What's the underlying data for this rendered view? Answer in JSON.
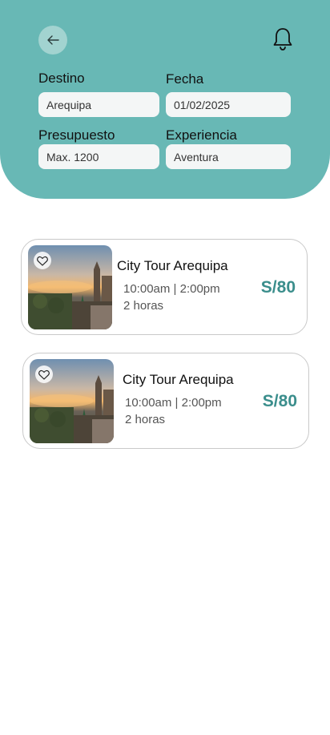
{
  "colors": {
    "header_bg": "#68b8b5",
    "accent": "#3b8e8c",
    "field_bg": "#f4f6f6"
  },
  "header": {
    "back_icon": "arrow-left-icon",
    "bell_icon": "bell-icon"
  },
  "filters": {
    "destino": {
      "label": "Destino",
      "value": "Arequipa"
    },
    "fecha": {
      "label": "Fecha",
      "value": "01/02/2025"
    },
    "presupuesto": {
      "label": "Presupuesto",
      "value": "Max. 1200"
    },
    "experiencia": {
      "label": "Experiencia",
      "value": "Aventura"
    }
  },
  "tours": [
    {
      "title": "City Tour Arequipa",
      "schedule": "10:00am | 2:00pm",
      "duration": "2 horas",
      "price": "S/80",
      "favorite_icon": "heart-icon"
    },
    {
      "title": "City Tour Arequipa",
      "schedule": "10:00am | 2:00pm",
      "duration": "2 horas",
      "price": "S/80",
      "favorite_icon": "heart-icon"
    }
  ]
}
